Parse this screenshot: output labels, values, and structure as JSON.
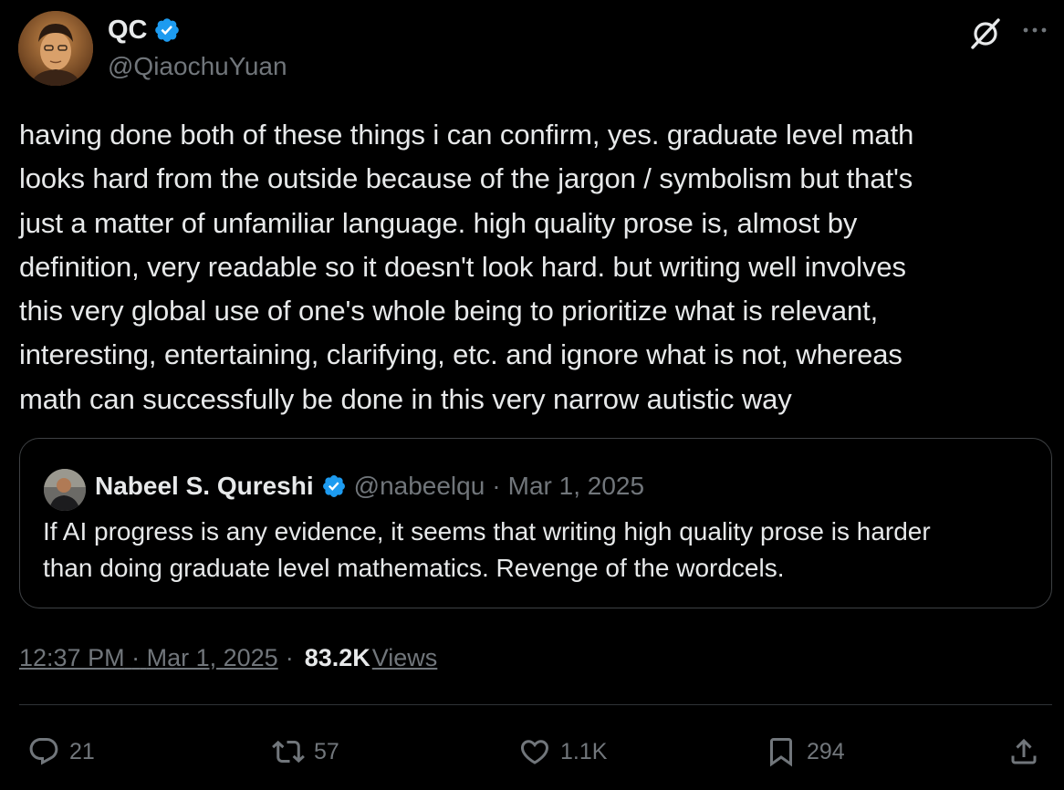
{
  "author": {
    "display_name": "QC",
    "handle": "@QiaochuYuan",
    "verified": true
  },
  "icons": {
    "verified": "verified-badge-icon",
    "grok": "grok-icon",
    "more": "more-icon"
  },
  "body_lines": [
    "having done both of these things i can confirm, yes. graduate level math",
    "looks hard from the outside because of the jargon / symbolism but that's",
    "just a matter of unfamiliar language. high quality prose is, almost by",
    "definition, very readable so it doesn't look hard. but writing well involves",
    "this very global use of one's whole being to prioritize what is relevant,",
    "interesting, entertaining, clarifying, etc. and ignore what is not, whereas",
    "math can successfully be done in this very narrow autistic way"
  ],
  "quote": {
    "display_name": "Nabeel S. Qureshi",
    "handle": "@nabeelqu",
    "separator": "·",
    "date": "Mar 1, 2025",
    "text_lines": [
      "If AI progress is any evidence, it seems that writing high quality prose is harder",
      "than doing graduate level mathematics. Revenge of the wordcels."
    ]
  },
  "meta": {
    "time": "12:37 PM",
    "date": "Mar 1, 2025",
    "separator": "·",
    "views_count": "83.2K",
    "views_label": "Views"
  },
  "actions": {
    "replies": "21",
    "reposts": "57",
    "likes": "1.1K",
    "bookmarks": "294"
  },
  "colors": {
    "background": "#000000",
    "text": "#e7e9ea",
    "secondary": "#71767b",
    "verified": "#1d9bf0",
    "border": "#3e4144"
  }
}
